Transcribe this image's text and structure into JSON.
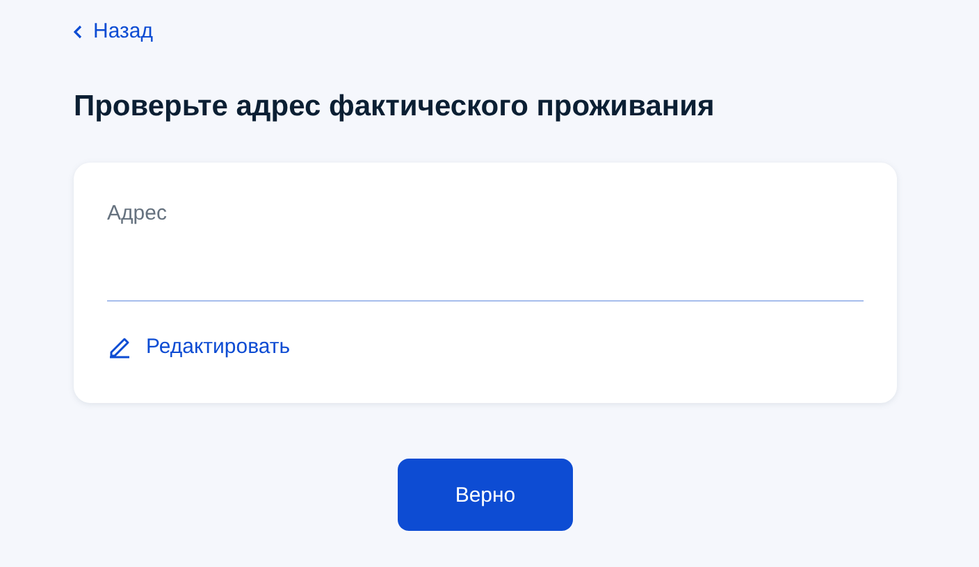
{
  "back_link": {
    "label": "Назад"
  },
  "title": "Проверьте адрес фактического проживания",
  "address_field": {
    "label": "Адрес"
  },
  "edit_link": {
    "label": "Редактировать"
  },
  "confirm_button": {
    "label": "Верно"
  }
}
